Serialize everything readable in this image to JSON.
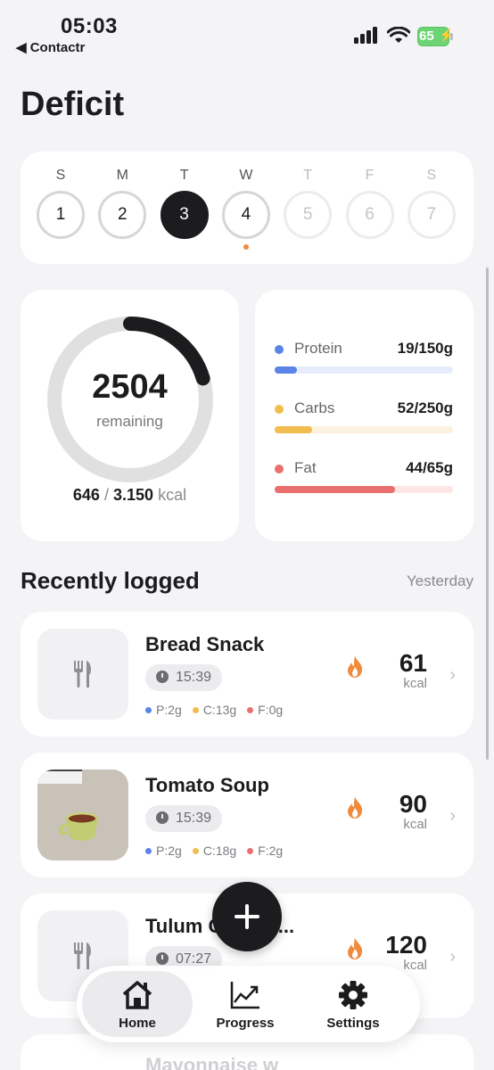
{
  "status_bar": {
    "time": "05:03",
    "back_label": "◀ Contactr",
    "battery": "65"
  },
  "page": {
    "title": "Deficit"
  },
  "week": [
    {
      "letter": "S",
      "number": "1",
      "state": "past"
    },
    {
      "letter": "M",
      "number": "2",
      "state": "past"
    },
    {
      "letter": "T",
      "number": "3",
      "state": "active"
    },
    {
      "letter": "W",
      "number": "4",
      "state": "today"
    },
    {
      "letter": "T",
      "number": "5",
      "state": "future"
    },
    {
      "letter": "F",
      "number": "6",
      "state": "future"
    },
    {
      "letter": "S",
      "number": "7",
      "state": "future"
    }
  ],
  "calories": {
    "remaining": "2504",
    "remaining_label": "remaining",
    "consumed": "646",
    "separator": "/",
    "goal": "3.150",
    "unit": "kcal",
    "progress": 0.205
  },
  "macros": [
    {
      "name": "Protein",
      "value": "19/150g",
      "progress": 0.127,
      "color": "#5b84e8",
      "track": "#e6ecfb"
    },
    {
      "name": "Carbs",
      "value": "52/250g",
      "progress": 0.208,
      "color": "#f2bd4f",
      "track": "#fdf1df"
    },
    {
      "name": "Fat",
      "value": "44/65g",
      "progress": 0.677,
      "color": "#ea7070",
      "track": "#fce6e6"
    }
  ],
  "recent": {
    "title": "Recently logged",
    "filter_label": "Yesterday",
    "items": [
      {
        "name": "Bread Snack",
        "time": "15:39",
        "protein": "P:2g",
        "carbs": "C:13g",
        "fat": "F:0g",
        "kcal": "61",
        "unit": "kcal",
        "has_photo": false
      },
      {
        "name": "Tomato Soup",
        "time": "15:39",
        "protein": "P:2g",
        "carbs": "C:18g",
        "fat": "F:2g",
        "kcal": "90",
        "unit": "kcal",
        "has_photo": true
      },
      {
        "name": "Tulum Cheese...",
        "time": "07:27",
        "protein": "",
        "carbs": "",
        "fat": "",
        "kcal": "120",
        "unit": "kcal",
        "has_photo": false
      }
    ],
    "partial_next": "Mayonnaise w"
  },
  "nav": [
    {
      "label": "Home",
      "icon": "home-icon",
      "selected": true
    },
    {
      "label": "Progress",
      "icon": "chart-line-icon",
      "selected": false
    },
    {
      "label": "Settings",
      "icon": "gear-icon",
      "selected": false
    }
  ],
  "colors": {
    "accent": "#1c1c1e",
    "flame": "#f08a3c"
  }
}
